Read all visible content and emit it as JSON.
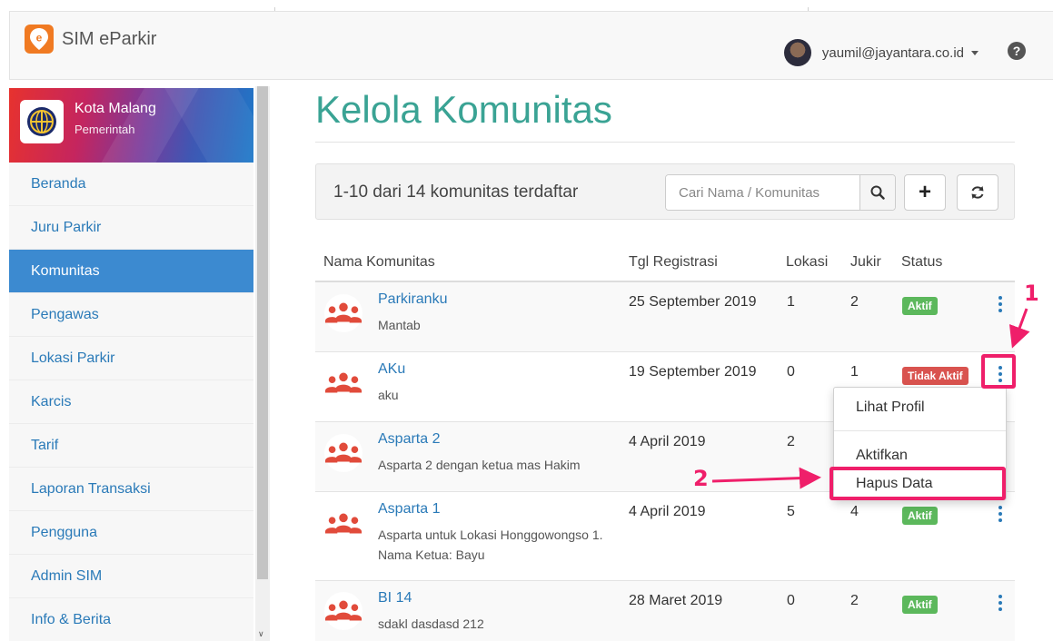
{
  "app": {
    "title": "SIM eParkir"
  },
  "user": {
    "email": "yaumil@jayantara.co.id"
  },
  "sidebar": {
    "org_name": "Kota Malang",
    "org_type": "Pemerintah",
    "items": [
      {
        "label": "Beranda"
      },
      {
        "label": "Juru Parkir"
      },
      {
        "label": "Komunitas"
      },
      {
        "label": "Pengawas"
      },
      {
        "label": "Lokasi Parkir"
      },
      {
        "label": "Karcis"
      },
      {
        "label": "Tarif"
      },
      {
        "label": "Laporan Transaksi"
      },
      {
        "label": "Pengguna"
      },
      {
        "label": "Admin SIM"
      },
      {
        "label": "Info & Berita"
      }
    ]
  },
  "page": {
    "title": "Kelola Komunitas"
  },
  "toolbar": {
    "count_text": "1-10 dari 14 komunitas terdaftar",
    "search_placeholder": "Cari Nama / Komunitas",
    "add_label": "+"
  },
  "table": {
    "headers": {
      "name": "Nama Komunitas",
      "date": "Tgl Registrasi",
      "lokasi": "Lokasi",
      "jukir": "Jukir",
      "status": "Status"
    },
    "rows": [
      {
        "name": "Parkiranku",
        "desc": "Mantab",
        "date": "25 September 2019",
        "lokasi": "1",
        "jukir": "2",
        "status": "Aktif"
      },
      {
        "name": "AKu",
        "desc": "aku",
        "date": "19 September 2019",
        "lokasi": "0",
        "jukir": "1",
        "status": "Tidak Aktif"
      },
      {
        "name": "Asparta 2",
        "desc": "Asparta 2 dengan ketua mas Hakim",
        "date": "4 April 2019",
        "lokasi": "2",
        "jukir": "",
        "status": ""
      },
      {
        "name": "Asparta 1",
        "desc": "Asparta untuk Lokasi Honggowongso 1. Nama Ketua: Bayu",
        "date": "4 April 2019",
        "lokasi": "5",
        "jukir": "4",
        "status": "Aktif"
      },
      {
        "name": "BI 14",
        "desc": "sdakl dasdasd 212",
        "date": "28 Maret 2019",
        "lokasi": "0",
        "jukir": "2",
        "status": "Aktif"
      }
    ]
  },
  "dropdown": {
    "items": [
      {
        "label": "Lihat Profil"
      },
      {
        "label": "Aktifkan"
      },
      {
        "label": "Hapus Data"
      }
    ]
  },
  "annotations": {
    "step1": "1",
    "step2": "2"
  },
  "colors": {
    "accent": "#3aa394",
    "link": "#2a7ab8",
    "active": "#3c8ad0",
    "annotation": "#ef1f6a",
    "success": "#5cb85c",
    "danger": "#d9534f",
    "brand": "#f07a22"
  }
}
